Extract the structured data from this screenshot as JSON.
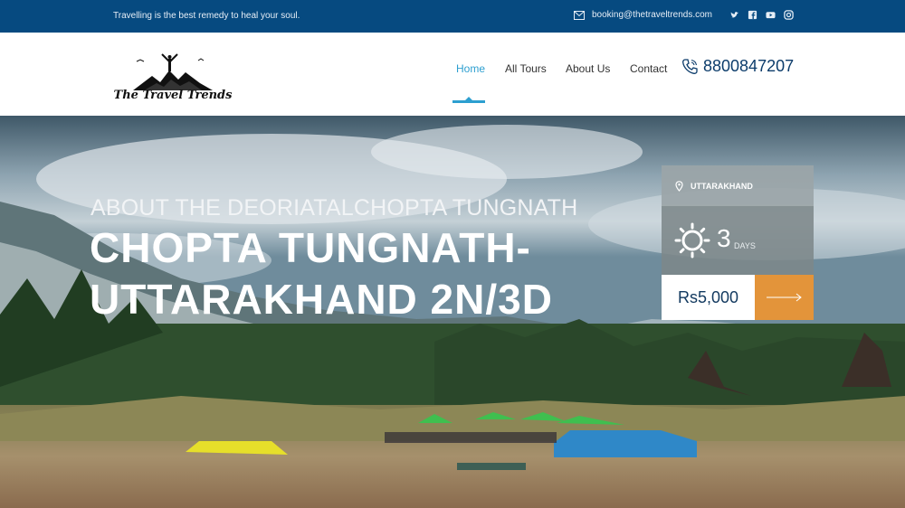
{
  "topbar": {
    "tagline": "Travelling is the best remedy to heal your soul.",
    "email": "booking@thetraveltrends.com",
    "social_icons": [
      "twitter-icon",
      "facebook-icon",
      "youtube-icon",
      "instagram-icon"
    ]
  },
  "header": {
    "logo_text": "The Travel Trends",
    "nav": [
      {
        "label": "Home",
        "active": true
      },
      {
        "label": "All Tours",
        "active": false
      },
      {
        "label": "About Us",
        "active": false
      },
      {
        "label": "Contact",
        "active": false
      }
    ],
    "phone": "8800847207"
  },
  "hero": {
    "subtitle": "ABOUT THE DEORIATALCHOPTA TUNGNATH",
    "title_line1": "CHOPTA TUNGNATH-",
    "title_line2": "UTTARAKHAND 2N/3D"
  },
  "card": {
    "location": "UTTARAKHAND",
    "days_number": "3",
    "days_label": "DAYS",
    "price": "Rs5,000"
  },
  "colors": {
    "topbar": "#064a80",
    "accent": "#2d9fd0",
    "orange": "#e3943a",
    "price_text": "#12395f"
  }
}
